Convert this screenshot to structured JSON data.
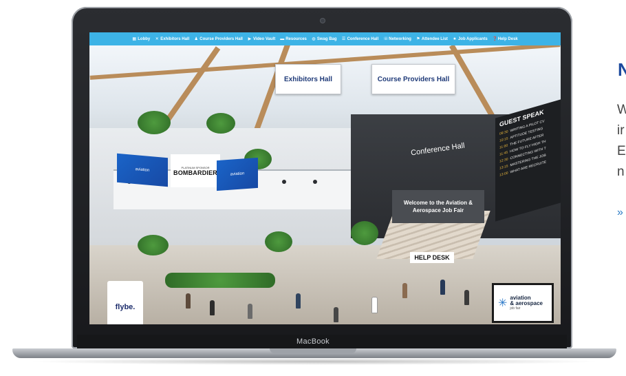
{
  "nav": {
    "items": [
      {
        "label": "Lobby",
        "icon": "lobby-icon",
        "glyph": "▦"
      },
      {
        "label": "Exhibitors Hall",
        "icon": "exhibitors-icon",
        "glyph": "✕"
      },
      {
        "label": "Course Providers Hall",
        "icon": "course-providers-icon",
        "glyph": "♟"
      },
      {
        "label": "Video Vault",
        "icon": "video-icon",
        "glyph": "▶"
      },
      {
        "label": "Resources",
        "icon": "resources-icon",
        "glyph": "▬"
      },
      {
        "label": "Swag Bag",
        "icon": "swag-bag-icon",
        "glyph": "◍"
      },
      {
        "label": "Conference Hall",
        "icon": "conference-icon",
        "glyph": "☰"
      },
      {
        "label": "Networking",
        "icon": "networking-icon",
        "glyph": "☏"
      },
      {
        "label": "Attendee List",
        "icon": "attendee-list-icon",
        "glyph": "⚑"
      },
      {
        "label": "Job Applicants",
        "icon": "job-applicants-icon",
        "glyph": "★"
      },
      {
        "label": "Help Desk",
        "icon": "help-desk-icon",
        "glyph": "❓"
      }
    ],
    "bg_color": "#3db3e6"
  },
  "scene": {
    "exhibitors_sign": "Exhibitors Hall",
    "course_providers_sign": "Course Providers Hall",
    "banner_left": "aviation",
    "banner_right": "aviation",
    "bombardier_top": "PLATINUM SPONSOR",
    "bombardier_name": "BOMBARDIER",
    "conference_hall": "Conference Hall",
    "welcome_text": "Welcome to the Aviation & Aerospace Job Fair",
    "guest_board": {
      "title": "GUEST SPEAK",
      "rows": [
        {
          "time": "09:30",
          "text": "WRITING A PILOT CV"
        },
        {
          "time": "10:15",
          "text": "APTITUDE TESTING"
        },
        {
          "time": "11:00",
          "text": "THE FUTURE AFTER"
        },
        {
          "time": "11:45",
          "text": "HOW TO FLY HIGH TH"
        },
        {
          "time": "12:30",
          "text": "CONNECTING WITH T"
        },
        {
          "time": "13:15",
          "text": "MASTERING THE JOB"
        },
        {
          "time": "13:00",
          "text": "WHAT ARE RECRUITE"
        }
      ]
    },
    "help_desk": "HELP DESK",
    "flybe": "flybe.",
    "aero_logo_line1": "aviation",
    "aero_logo_line2": "& aerospace",
    "aero_logo_sub": "job fair"
  },
  "laptop": {
    "brand": "MacBook"
  },
  "side": {
    "heading": "N",
    "lines": [
      "W",
      "ir",
      "E",
      "n"
    ],
    "link": "»"
  }
}
